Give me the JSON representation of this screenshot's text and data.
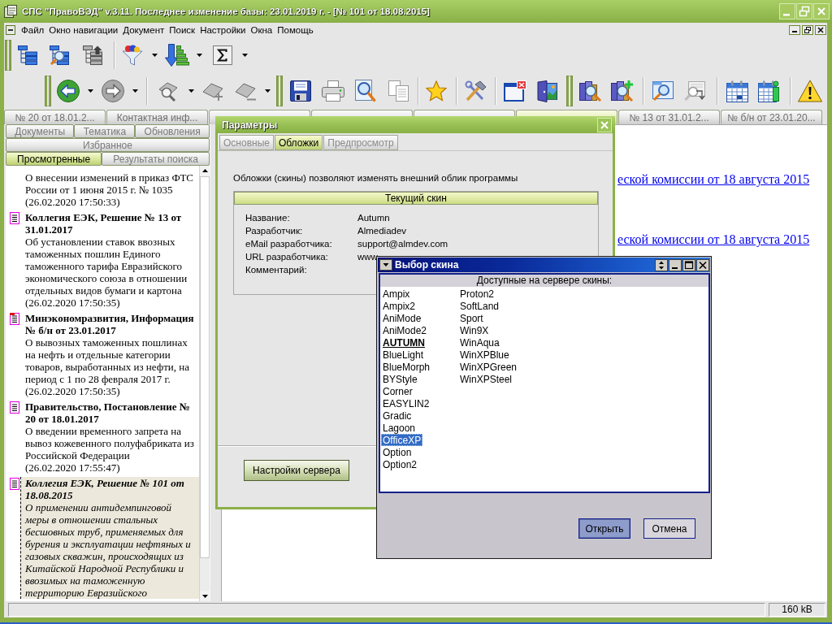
{
  "window": {
    "title": "СПС \"ПравоВЭД\" v.3.11. Последнее изменение базы: 23.01.2019 г. - [№ 101 от 18.08.2015]"
  },
  "menu": [
    "Файл",
    "Окно навигации",
    "Документ",
    "Поиск",
    "Настройки",
    "Окна",
    "Помощь"
  ],
  "document_tabs": [
    {
      "label": "№ 20 от 18.01.2...",
      "selected": false
    },
    {
      "label": "Контактная инф...",
      "selected": false
    },
    {
      "selected": false
    },
    {
      "selected": false
    },
    {
      "selected": false
    },
    {
      "selected": true
    },
    {
      "label": "№ 13 от 31.01.2...",
      "selected": false
    },
    {
      "label": "№ б/н от 23.01.20...",
      "selected": false
    }
  ],
  "nav_tabs": [
    [
      {
        "label": "Документы",
        "selected": false
      },
      {
        "label": "Тематика",
        "selected": false
      },
      {
        "label": "Обновления",
        "selected": false
      }
    ],
    [
      {
        "label": "Избранное",
        "selected": false
      }
    ],
    [
      {
        "label": "Просмотренные",
        "selected": true
      },
      {
        "label": "Результаты поиска",
        "selected": false
      }
    ]
  ],
  "history": {
    "items": [
      {
        "description": "О внесении изменений в приказ ФТС России от 1 июня 2015 г. № 1035",
        "date": "(26.02.2020 17:50:33)",
        "selected": false
      },
      {
        "kind": "document",
        "title": "Коллегия ЕЭК, Решение № 13 от 31.01.2017",
        "description": "Об установлении ставок ввозных таможенных пошлин Единого таможенного тарифа Евразийского экономического союза в отношении отдельных видов бумаги и картона",
        "date": "(26.02.2020 17:50:35)",
        "selected": false
      },
      {
        "kind": "flagged",
        "title": "Минэкономразвития, Информация № б/н от 23.01.2017",
        "description": "О вывозных таможенных пошлинах на нефть и отдельные категории товаров, выработанных из нефти, на период с 1 по 28 февраля 2017 г.",
        "date": "(26.02.2020 17:50:35)",
        "selected": false
      },
      {
        "kind": "document",
        "title": "Правительство, Постановление № 20 от 18.01.2017",
        "description": "О введении временного запрета на вывоз кожевенного полуфабриката из Российской Федерации",
        "date": "(26.02.2020 17:55:47)",
        "selected": false
      },
      {
        "kind": "document",
        "title": "Коллегия ЕЭК, Решение № 101 от 18.08.2015",
        "description": "О применении антидемпинговой меры в отношении стальных бесшовных труб, применяемых для бурения и эксплуатации нефтяных и газовых скважин, происходящих из Китайской Народной Республики и ввозимых на таможенную территорию Евразийского",
        "selected": true
      }
    ]
  },
  "document": {
    "links": [
      "еской комиссии от 18 августа 2015",
      "еской комиссии от 18 августа 2015"
    ]
  },
  "status_bar": {
    "size": "160 kB"
  },
  "parameters_dialog": {
    "title": "Параметры",
    "tabs": [
      {
        "label": "Основные",
        "selected": false
      },
      {
        "label": "Обложки",
        "selected": true
      },
      {
        "label": "Предпросмотр",
        "selected": false
      }
    ],
    "intro": "Обложки (скины) позволяют изменять внешний облик программы",
    "current_skin": {
      "title": "Текущий скин",
      "fields": [
        {
          "label": "Название:",
          "value": "Autumn"
        },
        {
          "label": "Разработчик:",
          "value": "Almediadev"
        },
        {
          "label": "eMail разработчика:",
          "value": "support@almdev.com"
        },
        {
          "label": "URL разработчика:",
          "value": "www"
        },
        {
          "label": "Комментарий:"
        }
      ]
    },
    "server_button": "Настройки сервера"
  },
  "skin_dialog": {
    "title": "Выбор скина",
    "list_header": "Доступные на сервере скины:",
    "skins": [
      {
        "name": "Ampix",
        "selected": false,
        "current": false
      },
      {
        "name": "Ampix2",
        "selected": false,
        "current": false
      },
      {
        "name": "AniMode",
        "selected": false,
        "current": false
      },
      {
        "name": "AniMode2",
        "selected": false,
        "current": false
      },
      {
        "name": "AUTUMN",
        "selected": false,
        "current": true
      },
      {
        "name": "BlueLight",
        "selected": false,
        "current": false
      },
      {
        "name": "BlueMorph",
        "selected": false,
        "current": false
      },
      {
        "name": "BYStyle",
        "selected": false,
        "current": false
      },
      {
        "name": "Corner",
        "selected": false,
        "current": false
      },
      {
        "name": "EASYLIN2",
        "selected": false,
        "current": false
      },
      {
        "name": "Gradic",
        "selected": false,
        "current": false
      },
      {
        "name": "Lagoon",
        "selected": false,
        "current": false
      },
      {
        "name": "OfficeXP",
        "selected": true,
        "current": false
      },
      {
        "name": "Option",
        "selected": false,
        "current": false
      },
      {
        "name": "Option2",
        "selected": false,
        "current": false
      },
      {
        "name": "Proton2",
        "selected": false,
        "current": false
      },
      {
        "name": "SoftLand",
        "selected": false,
        "current": false
      },
      {
        "name": "Sport",
        "selected": false,
        "current": false
      },
      {
        "name": "Win9X",
        "selected": false,
        "current": false
      },
      {
        "name": "WinAqua",
        "selected": false,
        "current": false
      },
      {
        "name": "WinXPBlue",
        "selected": false,
        "current": false
      },
      {
        "name": "WinXPGreen",
        "selected": false,
        "current": false
      },
      {
        "name": "WinXPSteel",
        "selected": false,
        "current": false
      }
    ],
    "buttons": [
      {
        "label": "Открыть",
        "default": true
      },
      {
        "label": "Отмена",
        "default": false
      }
    ]
  }
}
